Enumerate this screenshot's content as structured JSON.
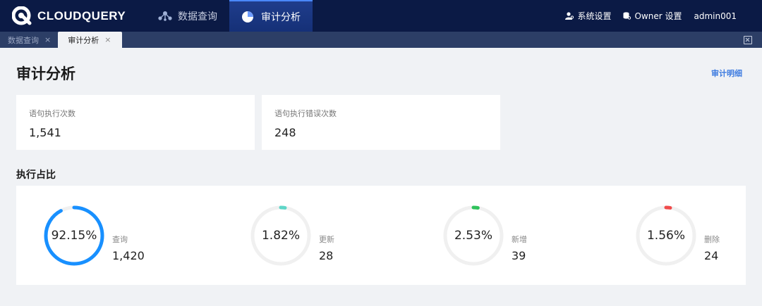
{
  "brand": {
    "name": "CLOUDQUERY"
  },
  "nav": {
    "items": [
      {
        "label": "数据查询",
        "icon": "share-nodes-icon"
      },
      {
        "label": "审计分析",
        "icon": "pie-chart-icon",
        "active": true
      }
    ]
  },
  "topright": {
    "system_settings": "系统设置",
    "owner_settings": "Owner 设置",
    "user": "admin001"
  },
  "tabs": [
    {
      "label": "数据查询",
      "close": "×"
    },
    {
      "label": "审计分析",
      "close": "×",
      "active": true
    }
  ],
  "page": {
    "title": "审计分析",
    "detail_link": "审计明细",
    "section_title": "执行占比"
  },
  "stats": [
    {
      "label": "语句执行次数",
      "value": "1,541"
    },
    {
      "label": "语句执行错误次数",
      "value": "248"
    }
  ],
  "ratios": [
    {
      "percent_label": "92.15%",
      "percent": 92.15,
      "category": "查询",
      "count": "1,420",
      "color": "#1890ff"
    },
    {
      "percent_label": "1.82%",
      "percent": 1.82,
      "category": "更新",
      "count": "28",
      "color": "#5fd6c8"
    },
    {
      "percent_label": "2.53%",
      "percent": 2.53,
      "category": "新增",
      "count": "39",
      "color": "#2fc25b"
    },
    {
      "percent_label": "1.56%",
      "percent": 1.56,
      "category": "删除",
      "count": "24",
      "color": "#f04b4b"
    }
  ],
  "colors": {
    "topbar_bg": "#0b1a45",
    "tabstrip_bg": "#2c3e66",
    "accent": "#3d7be0",
    "ring_track": "#f0f0f0"
  }
}
